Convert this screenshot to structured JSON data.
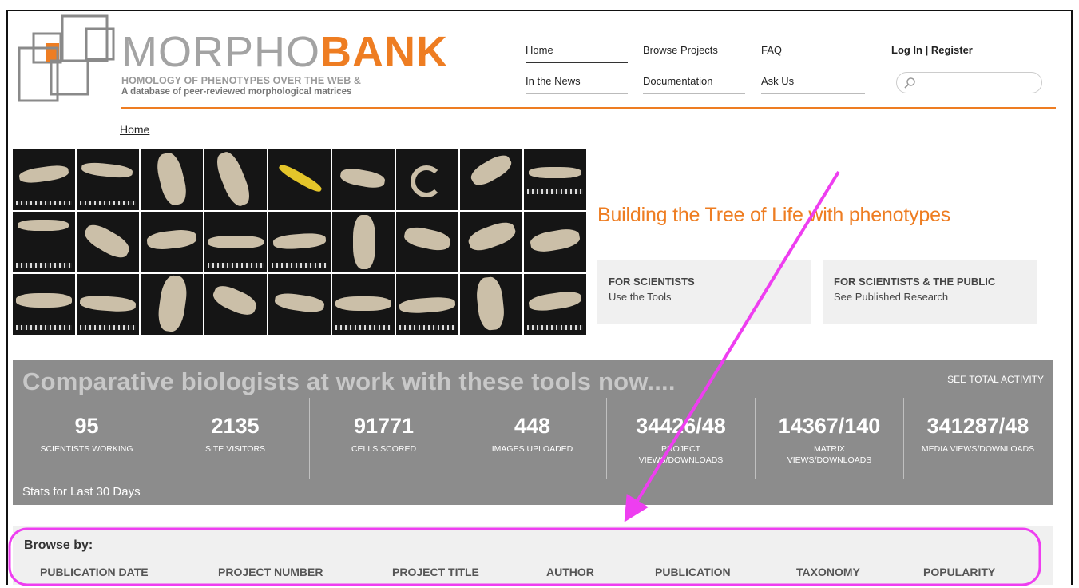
{
  "brand": {
    "name_part1": "MORPHO",
    "name_part2": "BANK",
    "tagline1": "HOMOLOGY OF PHENOTYPES OVER THE WEB &",
    "tagline2": "A database of peer-reviewed morphological matrices"
  },
  "nav": {
    "home": "Home",
    "browse_projects": "Browse Projects",
    "faq": "FAQ",
    "in_the_news": "In the News",
    "documentation": "Documentation",
    "ask_us": "Ask Us"
  },
  "account": {
    "login_register": "Log In | Register"
  },
  "search": {
    "placeholder": ""
  },
  "breadcrumb": "Home",
  "hero": {
    "tagline": "Building the Tree of Life with phenotypes"
  },
  "cards": [
    {
      "title": "FOR SCIENTISTS",
      "subtitle": "Use the Tools"
    },
    {
      "title": "FOR SCIENTISTS & THE PUBLIC",
      "subtitle": "See Published Research"
    }
  ],
  "stats": {
    "heading": "Comparative biologists at work with these tools now....",
    "see_total": "SEE TOTAL ACTIVITY",
    "footer": "Stats for Last 30 Days",
    "items": [
      {
        "value": "95",
        "label": "SCIENTISTS WORKING"
      },
      {
        "value": "2135",
        "label": "SITE VISITORS"
      },
      {
        "value": "91771",
        "label": "CELLS SCORED"
      },
      {
        "value": "448",
        "label": "IMAGES UPLOADED"
      },
      {
        "value": "34426/48",
        "label": "PROJECT VIEWS/DOWNLOADS"
      },
      {
        "value": "14367/140",
        "label": "MATRIX VIEWS/DOWNLOADS"
      },
      {
        "value": "341287/48",
        "label": "MEDIA VIEWS/DOWNLOADS"
      }
    ]
  },
  "browse": {
    "title": "Browse by:",
    "items": [
      "PUBLICATION DATE",
      "PROJECT NUMBER",
      "PROJECT TITLE",
      "AUTHOR",
      "PUBLICATION",
      "TAXONOMY",
      "POPULARITY"
    ]
  },
  "colors": {
    "accent": "#ee7d22",
    "stats_bg": "#8c8c8c",
    "annotation": "#ee3ef0"
  }
}
